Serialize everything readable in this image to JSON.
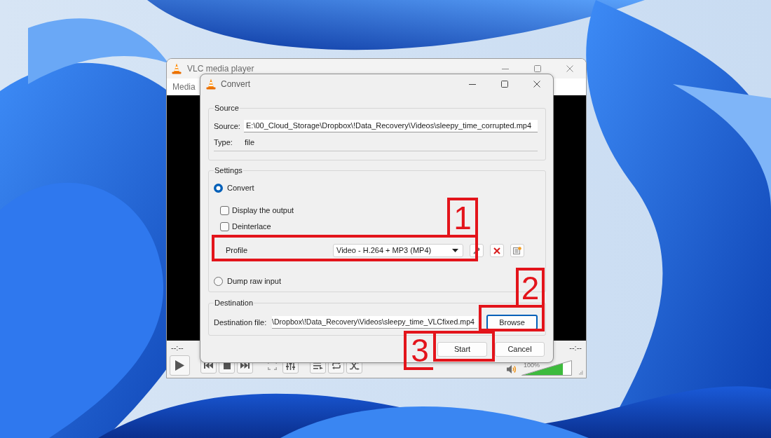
{
  "player_window": {
    "title": "VLC media player",
    "menu": [
      "Media"
    ],
    "time_elapsed": "--:--",
    "time_remaining": "--:--",
    "volume": {
      "reading": "100%",
      "level": 0.82
    }
  },
  "convert_dialog": {
    "title": "Convert",
    "source": {
      "heading": "Source",
      "source_label": "Source:",
      "source_value": "E:\\00_Cloud_Storage\\Dropbox\\!Data_Recovery\\Videos\\sleepy_time_corrupted.mp4",
      "type_label": "Type:",
      "type_value": "file"
    },
    "settings": {
      "heading": "Settings",
      "modes": [
        {
          "label": "Convert",
          "selected": true
        },
        {
          "label": "Dump raw input",
          "selected": false
        }
      ],
      "options": [
        {
          "label": "Display the output",
          "checked": false
        },
        {
          "label": "Deinterlace",
          "checked": false
        }
      ],
      "profile": {
        "label": "Profile",
        "value": "Video - H.264 + MP3 (MP4)"
      }
    },
    "destination": {
      "heading": "Destination",
      "label": "Destination file:",
      "value": "\\Dropbox\\!Data_Recovery\\Videos\\sleepy_time_VLCfixed.mp4",
      "browse": {
        "label": "Browse",
        "focused": true
      }
    },
    "buttons": [
      "Start",
      "Cancel"
    ]
  },
  "annotations": [
    {
      "label": "1"
    },
    {
      "label": "2"
    },
    {
      "label": "3"
    }
  ]
}
